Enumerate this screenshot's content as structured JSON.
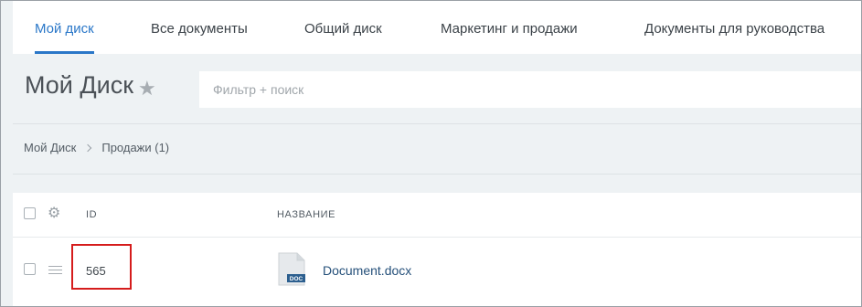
{
  "tabs": [
    {
      "label": "Мой диск",
      "active": true
    },
    {
      "label": "Все документы",
      "active": false
    },
    {
      "label": "Общий диск",
      "active": false
    },
    {
      "label": "Маркетинг и продажи",
      "active": false
    },
    {
      "label": "Документы для руководства",
      "active": false
    }
  ],
  "header": {
    "title": "Мой Диск",
    "star_icon": "star-icon",
    "search_placeholder": "Фильтр + поиск"
  },
  "breadcrumb": [
    {
      "label": "Мой Диск"
    },
    {
      "label": "Продажи (1)"
    }
  ],
  "table": {
    "columns": {
      "id": "ID",
      "name": "НАЗВАНИЕ"
    },
    "rows": [
      {
        "id": "565",
        "name": "Document.docx",
        "file_badge": "DOC"
      }
    ]
  },
  "colors": {
    "accent": "#2a77c8",
    "highlight": "#d51c1c",
    "doc_badge": "#2c5f8f"
  }
}
